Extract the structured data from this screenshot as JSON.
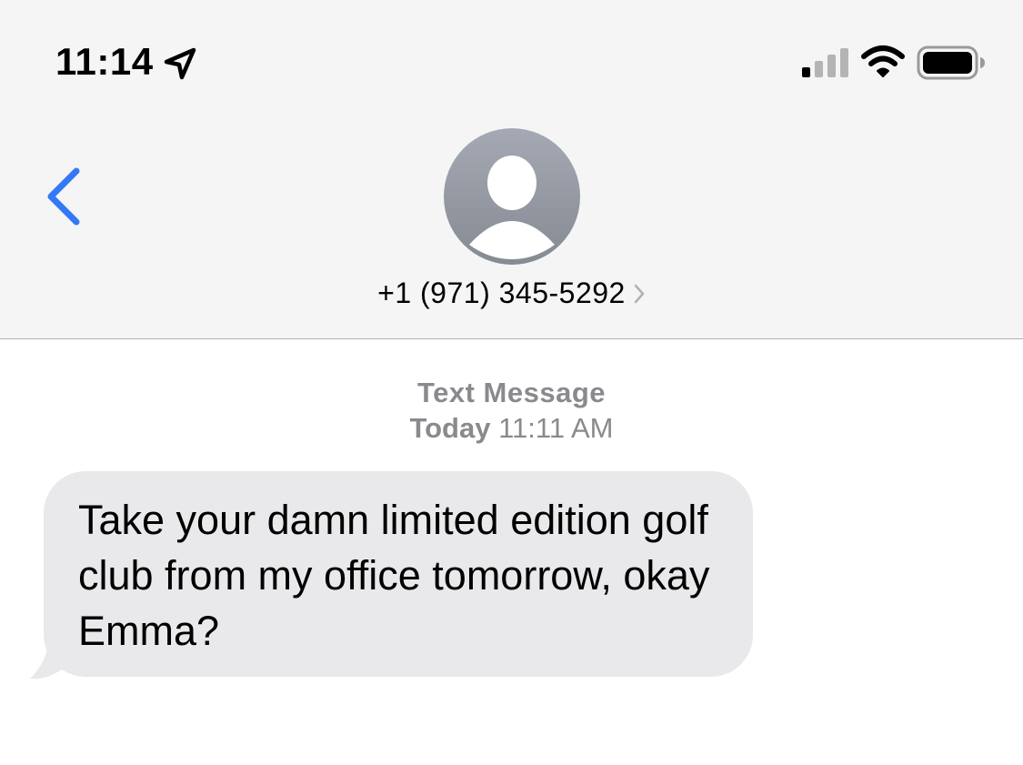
{
  "status_bar": {
    "time": "11:14",
    "icons": [
      "location-arrow-icon",
      "cellular-signal-icon",
      "wifi-icon",
      "battery-icon"
    ]
  },
  "nav": {
    "back_icon": "chevron-left-icon",
    "avatar_icon": "person-silhouette-icon",
    "contact": "+1 (971) 345-5292",
    "contact_chevron_icon": "chevron-right-icon"
  },
  "conversation": {
    "service": "Text Message",
    "timestamp_day": "Today",
    "timestamp_time": "11:11 AM",
    "messages": [
      {
        "direction": "incoming",
        "text": "Take your damn limited edition golf club from my office tomorrow, okay Emma?"
      }
    ]
  },
  "colors": {
    "accent": "#3478f6",
    "header_background": "#f5f5f5",
    "incoming_bubble": "#e9e9eb",
    "secondary_text": "#8a8a8e"
  }
}
